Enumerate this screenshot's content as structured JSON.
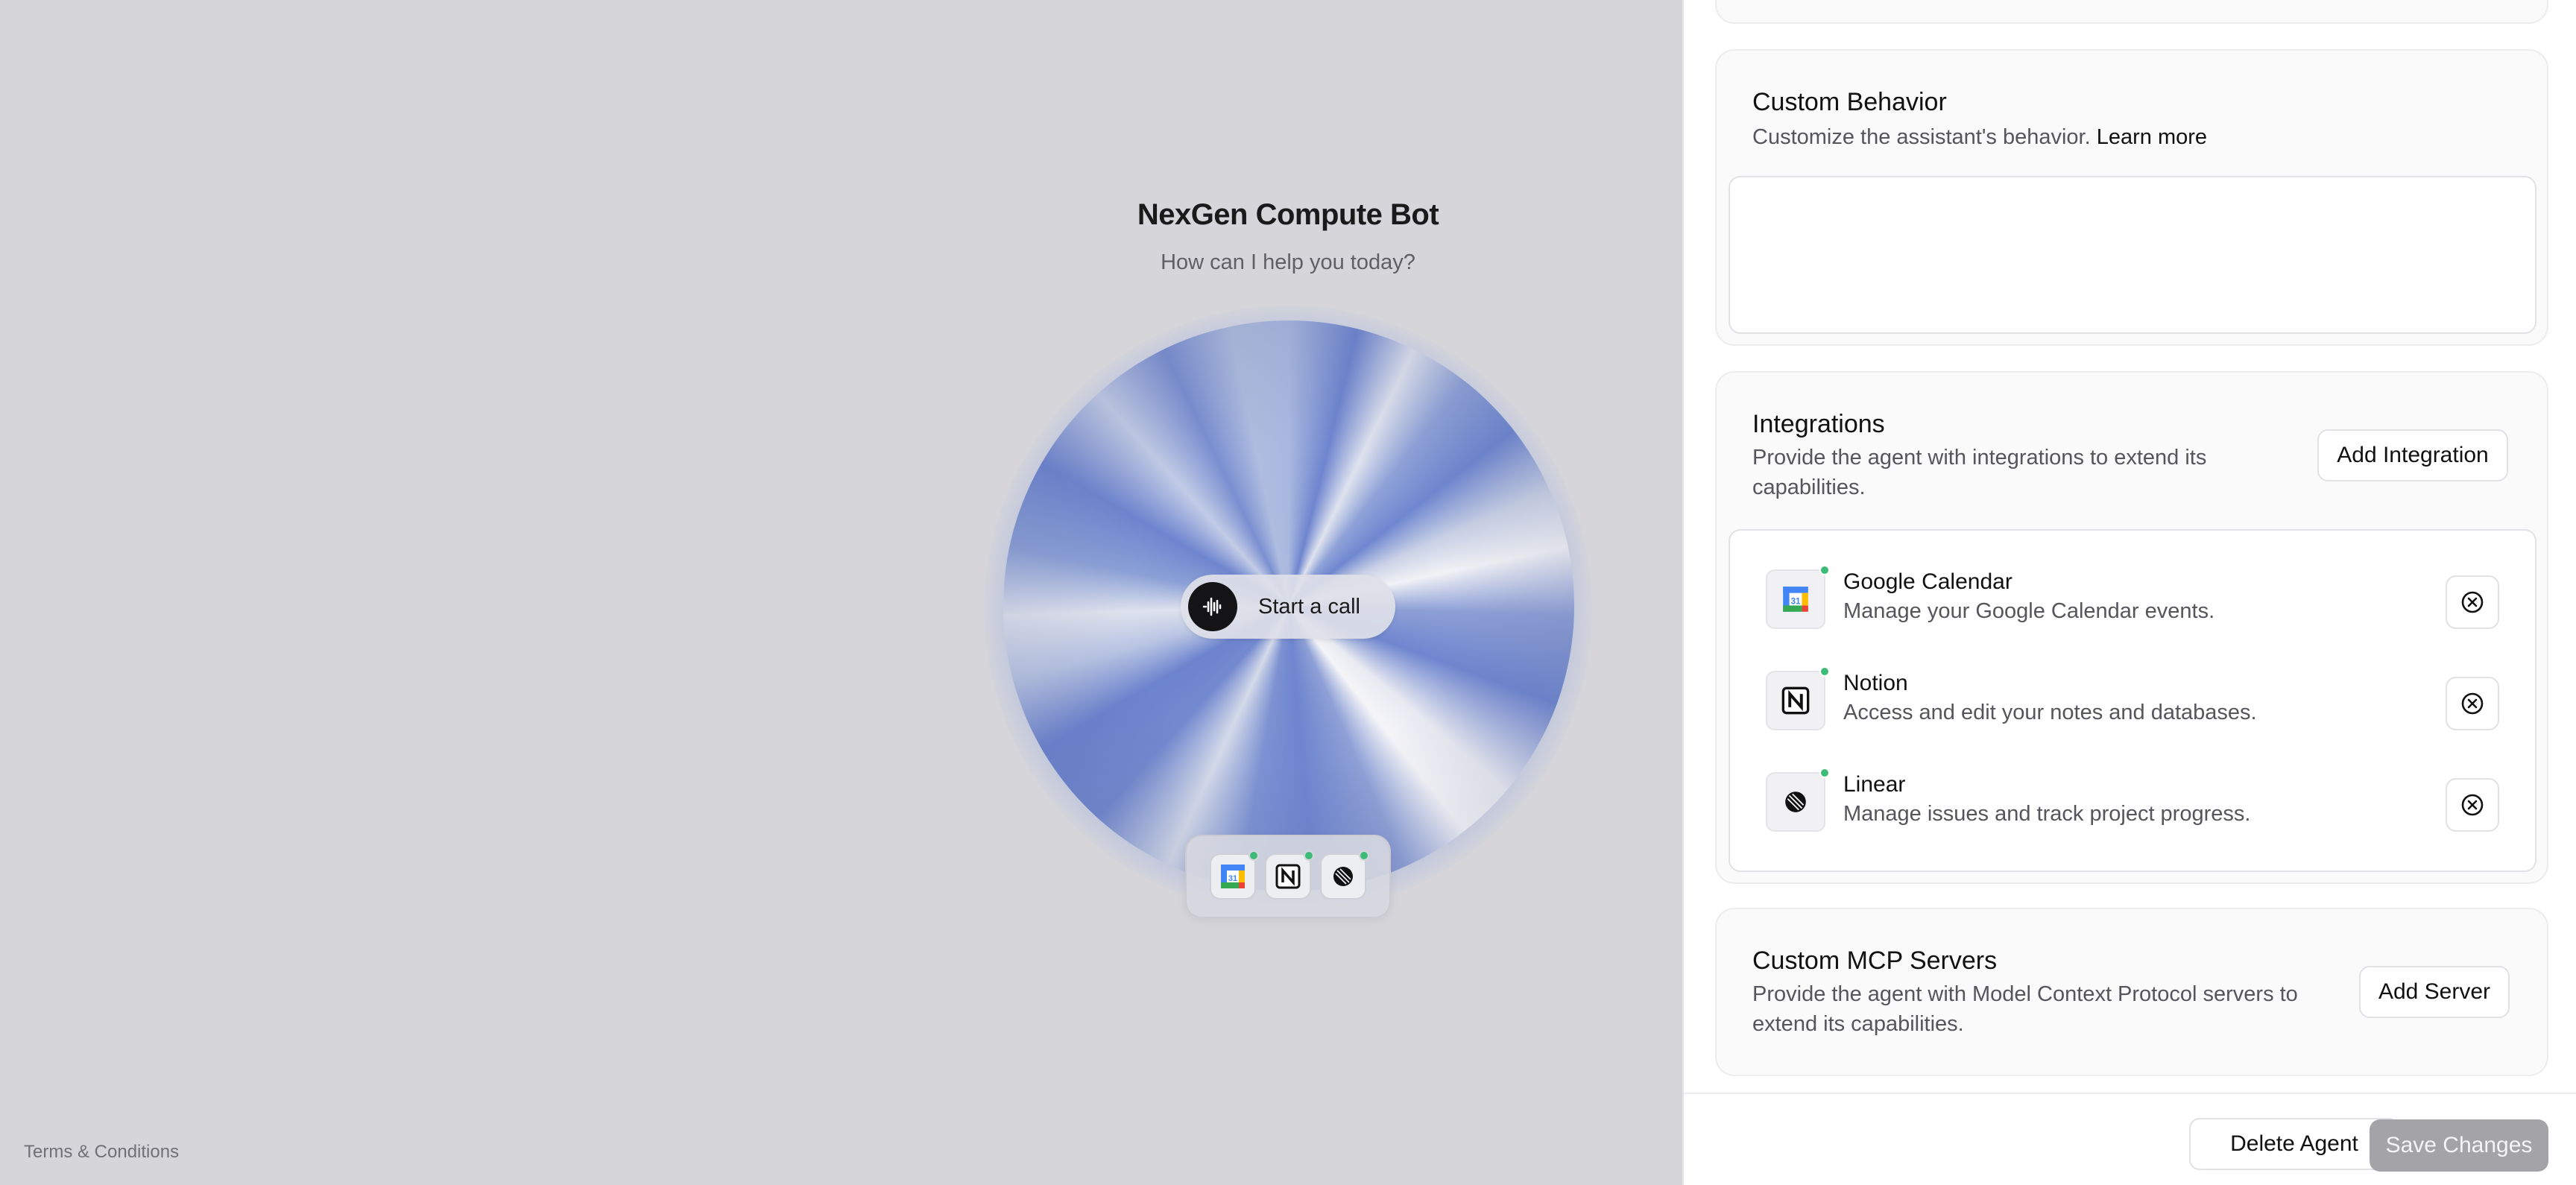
{
  "preview": {
    "bot_name": "NexGen Compute Bot",
    "greeting": "How can I help you today?",
    "call_button_label": "Start a call",
    "tray_icons": [
      "google-calendar-icon",
      "notion-icon",
      "linear-icon"
    ],
    "terms_link": "Terms & Conditions"
  },
  "custom_behavior": {
    "title": "Custom Behavior",
    "description": "Customize the assistant's behavior.",
    "learn_more": "Learn more",
    "value": ""
  },
  "integrations": {
    "title": "Integrations",
    "description": "Provide the agent with integrations to extend its capabilities.",
    "add_button": "Add Integration",
    "items": [
      {
        "name": "Google Calendar",
        "description": "Manage your Google Calendar events.",
        "icon": "google-calendar-icon",
        "status_color": "#3dbb78"
      },
      {
        "name": "Notion",
        "description": "Access and edit your notes and databases.",
        "icon": "notion-icon",
        "status_color": "#3dbb78"
      },
      {
        "name": "Linear",
        "description": "Manage issues and track project progress.",
        "icon": "linear-icon",
        "status_color": "#3dbb78"
      }
    ]
  },
  "mcp": {
    "title": "Custom MCP Servers",
    "description": "Provide the agent with Model Context Protocol servers to extend its capabilities.",
    "add_button": "Add Server"
  },
  "footer": {
    "delete_label": "Delete Agent",
    "save_label": "Save Changes"
  },
  "colors": {
    "accent_orb": "#6e85cf",
    "status_online": "#3dbb78",
    "save_disabled": "#a4a4a8"
  }
}
